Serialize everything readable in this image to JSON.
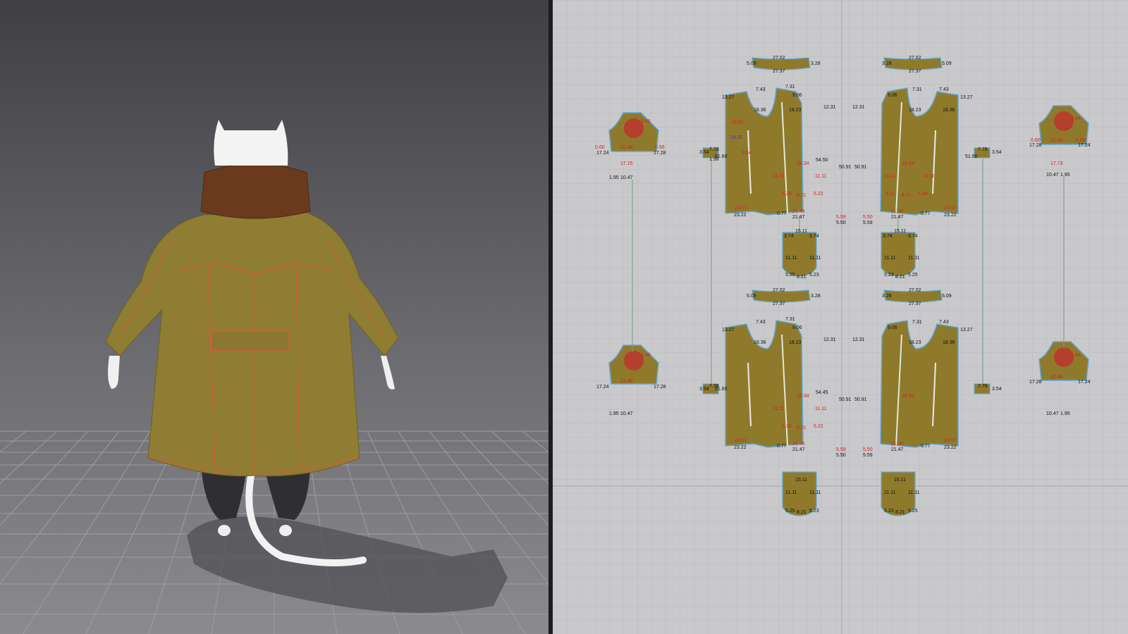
{
  "viewports": {
    "avatar": {
      "name": "3D avatar window",
      "garment_color": "#8e7d32",
      "scarf_color": "#6b3a1e",
      "seam_color": "#d85a3a"
    },
    "pattern": {
      "name": "2D pattern window",
      "piece_color": "#8f7a2c",
      "outline_color": "#5fa8d8",
      "grid_color": "#b9b9bc"
    }
  },
  "pattern": {
    "collar": {
      "top": "27.02",
      "bottom": "27.37",
      "left": "5.09",
      "right": "3.28"
    },
    "front_panel": {
      "a": "7.43",
      "b": "7.31",
      "c": "13.27",
      "d": "9.06",
      "e": "18.36",
      "f": "18.23",
      "g": "12.31",
      "h": "50.91",
      "i": "51.60",
      "j": "54.50",
      "k": "54.45",
      "l": "23.17",
      "m": "23.22",
      "n": "21.46",
      "o": "21.47",
      "p": "0.77",
      "q": "5.59",
      "r": "5.50",
      "s": "15.34",
      "t": "11.11",
      "u": "5.25",
      "v": "8.21",
      "w": "5.22",
      "x": "3.54",
      "y": "18.61",
      "z": "14.37"
    },
    "sleeve": {
      "a": "17.24",
      "b": "17.28",
      "c": "0.60",
      "d": "0.56",
      "e": "22.48",
      "f": "1.95",
      "g": "10.47",
      "h": "17.15",
      "i": "17.73",
      "j": "3.46",
      "k": "3.84"
    },
    "pocket": {
      "a": "15.11",
      "b": "3.74",
      "c": "11.11",
      "d": "5.25",
      "e": "8.21",
      "f": "5.23"
    },
    "cuff": {
      "a": "7.78",
      "b": "3.54",
      "c": "1.98"
    }
  }
}
